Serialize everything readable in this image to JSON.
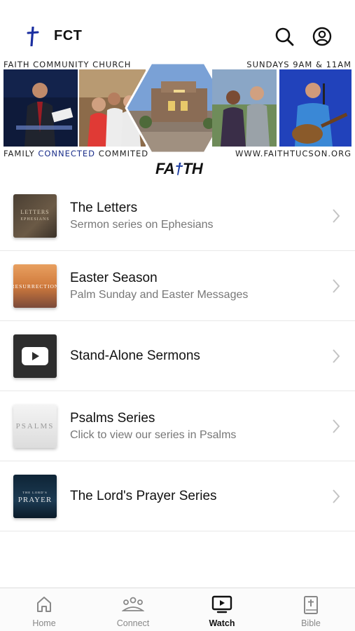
{
  "header": {
    "title": "FCT",
    "icons": [
      "cross-logo-icon",
      "search-icon",
      "account-icon"
    ]
  },
  "banner": {
    "top_left": "FAITH COMMUNITY CHURCH",
    "top_right": "SUNDAYS 9AM & 11AM",
    "bottom_left_1": "FAMILY ",
    "bottom_left_hl": "CONNECTED",
    "bottom_left_2": " COMMITED",
    "bottom_right": "WWW.FAITHTUCSON.ORG",
    "logo_a": "FA",
    "logo_cross": "†",
    "logo_b": "TH"
  },
  "list": {
    "items": [
      {
        "title": "The Letters",
        "subtitle": "Sermon series on Ephesians",
        "thumb_line1": "LETTERS",
        "thumb_line2": "EPHESIANS"
      },
      {
        "title": "Easter Season",
        "subtitle": "Palm Sunday and Easter Messages",
        "thumb_line1": "RESURRECTION",
        "thumb_line2": ""
      },
      {
        "title": "Stand-Alone Sermons",
        "subtitle": "",
        "thumb_icon": "play-icon"
      },
      {
        "title": "Psalms Series",
        "subtitle": "Click to view our series in Psalms",
        "thumb_line1": "PSALMS",
        "thumb_line2": ""
      },
      {
        "title": "The Lord's Prayer Series",
        "subtitle": "",
        "thumb_line1": "PRAYER",
        "thumb_line2": "THE LORD'S"
      }
    ]
  },
  "tabbar": {
    "tabs": [
      {
        "label": "Home",
        "icon": "home-icon",
        "active": false
      },
      {
        "label": "Connect",
        "icon": "people-icon",
        "active": false
      },
      {
        "label": "Watch",
        "icon": "tv-play-icon",
        "active": true
      },
      {
        "label": "Bible",
        "icon": "bible-icon",
        "active": false
      }
    ]
  },
  "colors": {
    "accent": "#1a2e8a",
    "divider": "#e8e8e8",
    "subtitle": "#777777"
  }
}
